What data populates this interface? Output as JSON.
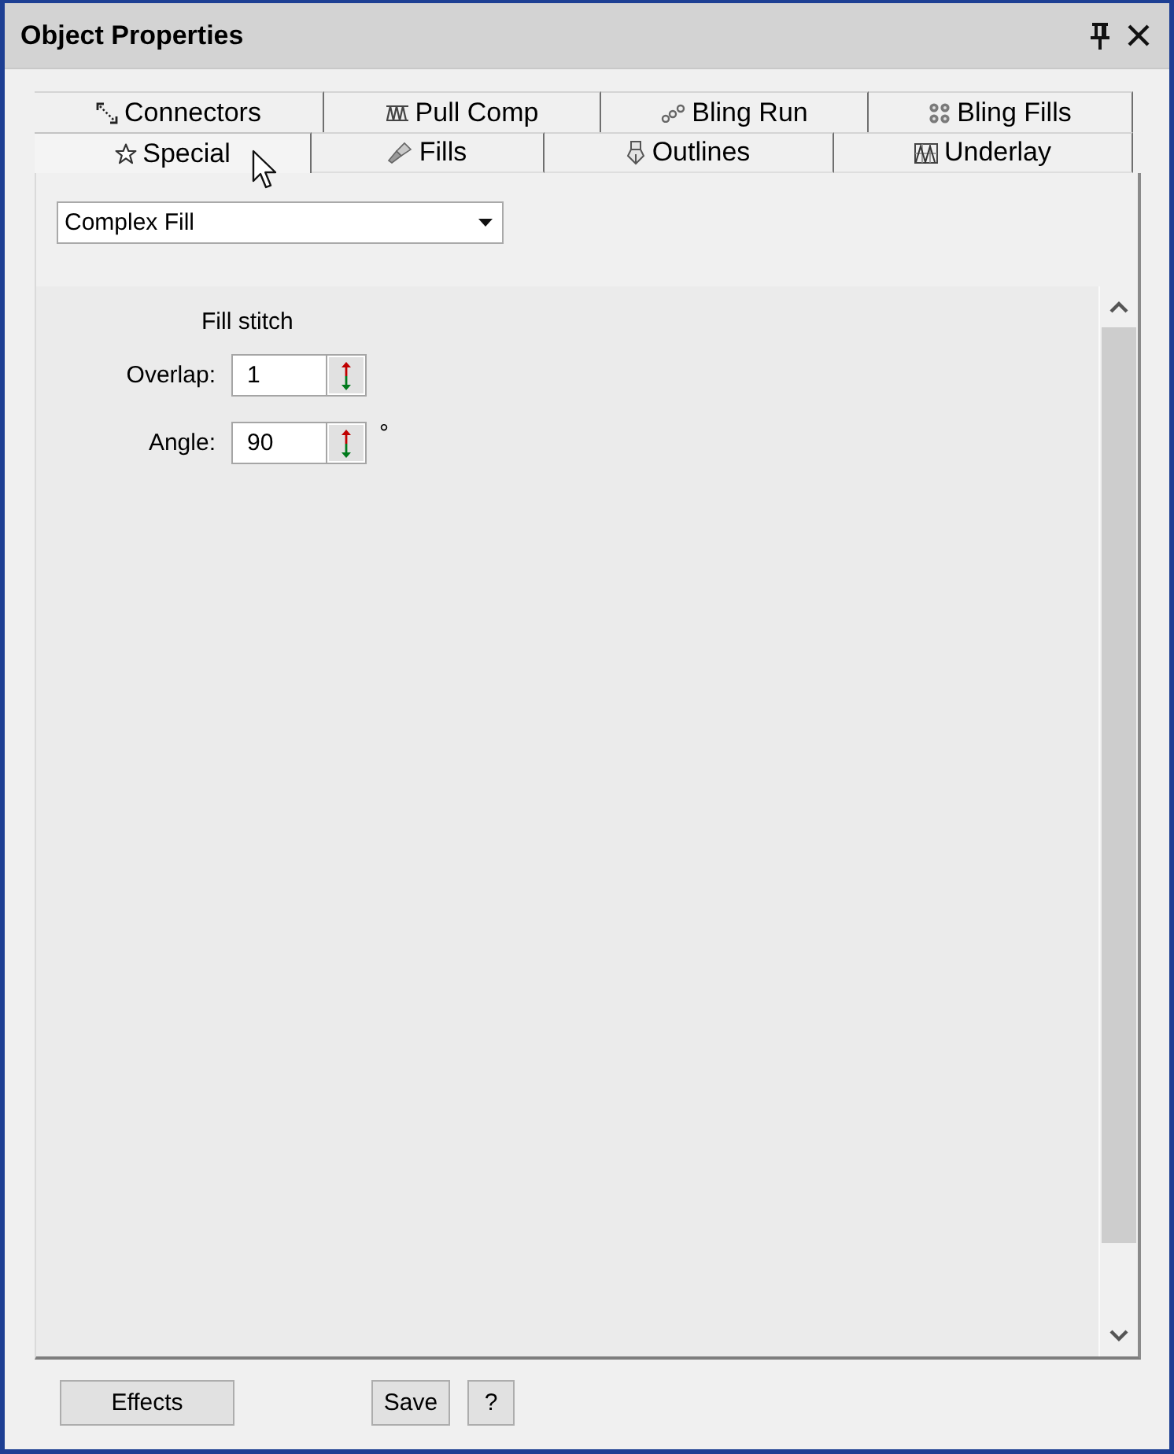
{
  "window": {
    "title": "Object Properties"
  },
  "tab_rows": [
    {
      "tabs": [
        {
          "label": "Connectors",
          "selected": false
        },
        {
          "label": "Pull Comp",
          "selected": false
        },
        {
          "label": "Bling Run",
          "selected": false
        },
        {
          "label": "Bling Fills",
          "selected": false
        }
      ]
    },
    {
      "tabs": [
        {
          "label": "Special",
          "selected": true
        },
        {
          "label": "Fills",
          "selected": false
        },
        {
          "label": "Outlines",
          "selected": false
        },
        {
          "label": "Underlay",
          "selected": false
        }
      ]
    }
  ],
  "fill_type": {
    "value": "Complex Fill"
  },
  "fill_stitch": {
    "title": "Fill stitch",
    "fields": [
      {
        "label": "Overlap:",
        "value": "1"
      },
      {
        "label": "Angle:",
        "value": "90",
        "unit": "°"
      }
    ]
  },
  "buttons": [
    "Effects",
    "Save",
    "?"
  ]
}
